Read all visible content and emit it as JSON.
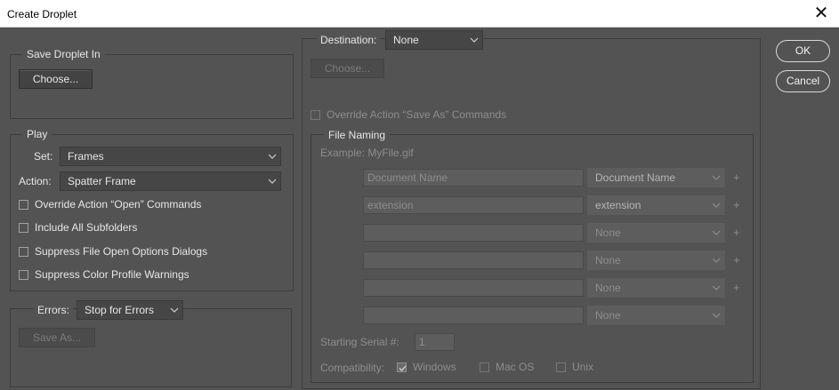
{
  "window": {
    "title": "Create Droplet",
    "close_glyph": "✕"
  },
  "save_droplet": {
    "legend": "Save Droplet In",
    "choose_label": "Choose..."
  },
  "play": {
    "legend": "Play",
    "set_label": "Set:",
    "set_value": "Frames",
    "action_label": "Action:",
    "action_value": "Spatter Frame",
    "checkboxes": [
      {
        "label": "Override Action “Open” Commands",
        "checked": false
      },
      {
        "label": "Include All Subfolders",
        "checked": false
      },
      {
        "label": "Suppress File Open Options Dialogs",
        "checked": false
      },
      {
        "label": "Suppress Color Profile Warnings",
        "checked": false
      }
    ]
  },
  "errors": {
    "label": "Errors:",
    "value": "Stop for Errors",
    "save_as_label": "Save As..."
  },
  "destination": {
    "label": "Destination:",
    "value": "None",
    "choose_label": "Choose...",
    "override_label": "Override Action “Save As” Commands"
  },
  "file_naming": {
    "legend": "File Naming",
    "example": "Example: MyFile.gif",
    "rows": [
      {
        "field": "Document Name",
        "select": "Document Name",
        "plus": "+"
      },
      {
        "field": "extension",
        "select": "extension",
        "plus": "+"
      },
      {
        "field": "",
        "select": "None",
        "plus": "+"
      },
      {
        "field": "",
        "select": "None",
        "plus": "+"
      },
      {
        "field": "",
        "select": "None",
        "plus": "+"
      },
      {
        "field": "",
        "select": "None",
        "plus": ""
      }
    ],
    "serial_label": "Starting Serial #:",
    "serial_value": "1",
    "compat_label": "Compatibility:",
    "compat_windows": "Windows",
    "compat_mac": "Mac OS",
    "compat_unix": "Unix"
  },
  "buttons": {
    "ok": "OK",
    "cancel": "Cancel"
  },
  "colors": {
    "dialog_bg": "#535353",
    "group_border": "#3d3d3d",
    "titlebar_bg": "#ffffff"
  },
  "icons": {
    "dropdown": "chevron-down-icon",
    "close": "close-icon",
    "check": "checkmark-icon"
  }
}
